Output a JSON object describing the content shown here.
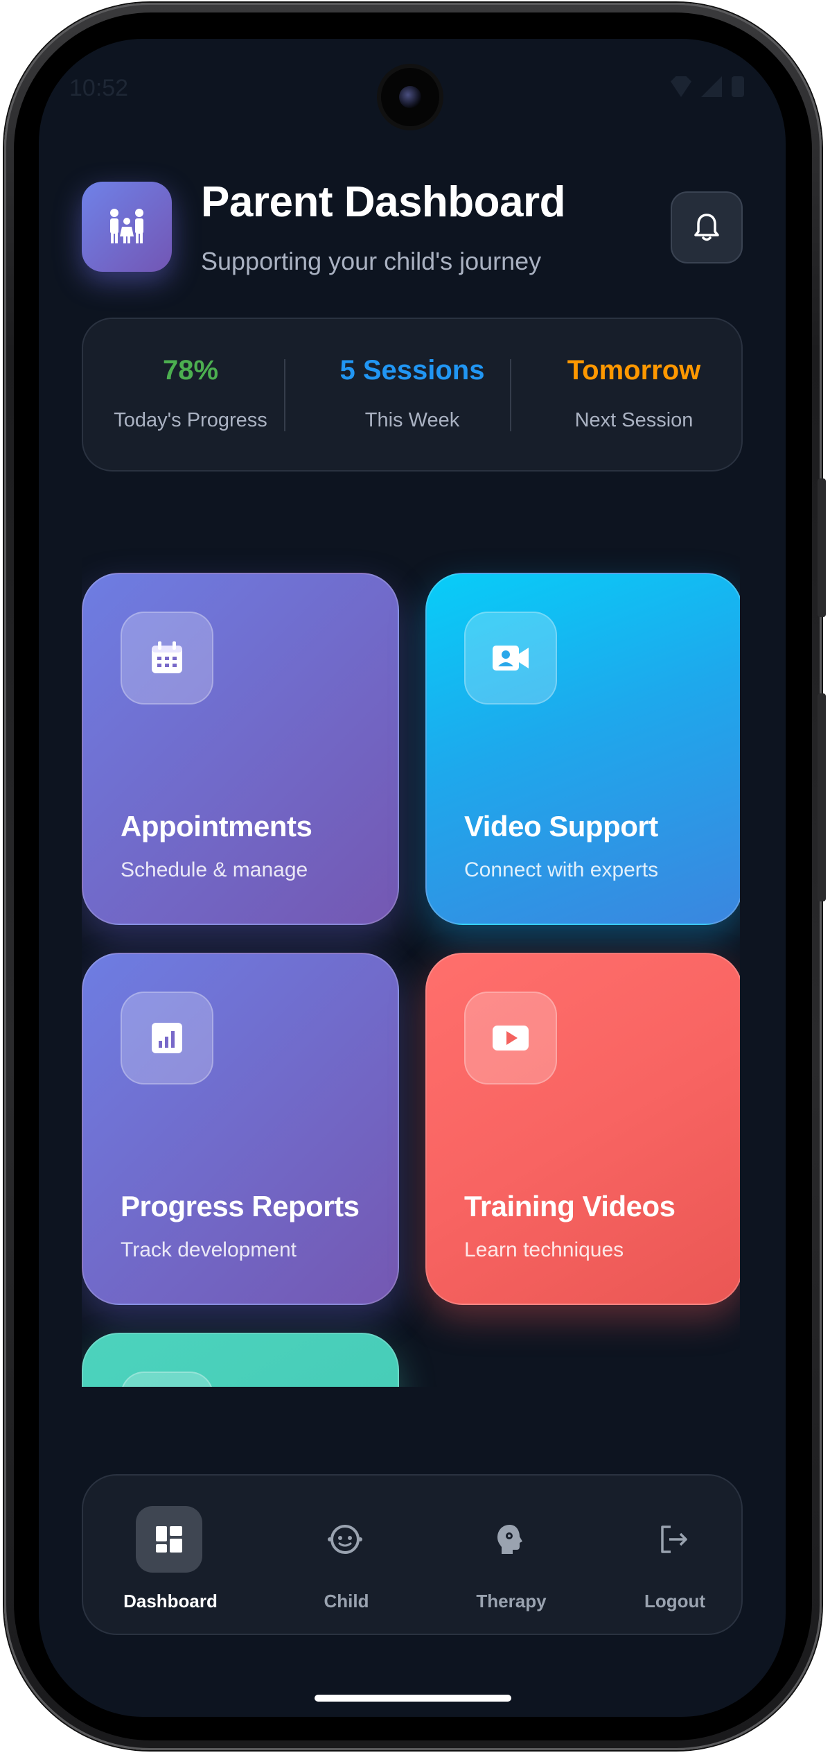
{
  "status_bar": {
    "time": "10:52"
  },
  "header": {
    "title": "Parent Dashboard",
    "subtitle": "Supporting your child's journey",
    "app_icon": "family-icon",
    "notification_icon": "bell-icon"
  },
  "stats": [
    {
      "value": "78%",
      "label": "Today's Progress",
      "color": "#4caf50"
    },
    {
      "value": "5 Sessions",
      "label": "This Week",
      "color": "#2196f3"
    },
    {
      "value": "Tomorrow",
      "label": "Next Session",
      "color": "#ff9800"
    }
  ],
  "cards": [
    {
      "title": "Appointments",
      "subtitle": "Schedule & manage",
      "icon": "calendar-icon"
    },
    {
      "title": "Video Support",
      "subtitle": "Connect with experts",
      "icon": "video-call-icon"
    },
    {
      "title": "Progress Reports",
      "subtitle": "Track development",
      "icon": "chart-icon"
    },
    {
      "title": "Training Videos",
      "subtitle": "Learn techniques",
      "icon": "play-icon"
    },
    {
      "title": "",
      "subtitle": "",
      "icon": "book-icon"
    }
  ],
  "bottom_nav": [
    {
      "label": "Dashboard",
      "icon": "dashboard-icon",
      "active": true
    },
    {
      "label": "Child",
      "icon": "child-face-icon",
      "active": false
    },
    {
      "label": "Therapy",
      "icon": "therapy-head-icon",
      "active": false
    },
    {
      "label": "Logout",
      "icon": "logout-icon",
      "active": false
    }
  ]
}
